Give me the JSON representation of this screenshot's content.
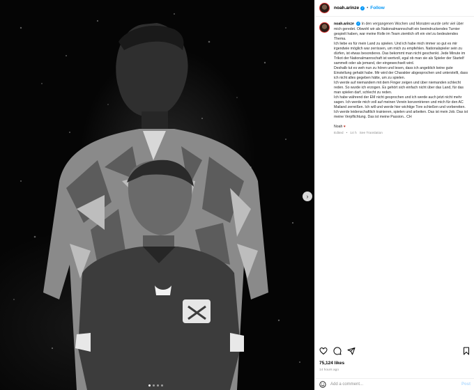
{
  "post": {
    "username": "noah.arinze",
    "follow_label": "Follow",
    "separator": "•",
    "caption": "In den vergangenen Wochen und Monaten wurde sehr viel über mich geredet. Obwohl wir als Nationalmannschaft ein beeindruckendes Turnier gespielt haben, war meine Rolle im Team ziemlich oft ein viel zu bedeutendes Thema.\nIch liebe es für mein Land zu spielen. Und ich habe mich immer so gut es mir irgendwie möglich war zerrissen, um mich zu empfehlen. Nationalspieler sein zu dürfen, ist etwas besonderes. Das bekommt man nicht geschenkt. Jede Minute im Trikot der Nationalmannschaft ist wertvoll, egal ob man sie als Spieler der Startelf sammelt oder als jemand, der eingewechselt wird.\nDeshalb tut es weh nun zu hören und lesen, dass ich angeblich keine gute Einstellung gehabt habe. Mir wird der Charakter abgesprochen und unterstellt, dass ich nicht alles gegeben hätte, um zu spielen.\nIch werde auf niemandem mit dem Finger zeigen und über niemanden schlecht reden. So wurde ich erzogen. Es gehört sich einfach nicht über das Land, für das man spielen darf, schlecht zu reden.\nIch habe während der EM nicht gesprochen und ich werde auch jetzt nicht mehr sagen. Ich werde mich voll auf meinen Verein konzentrieren und mich für den AC Mailand zerreißen. Ich will und werde hier wichtige Tore schießen und vorbereiten. Ich werde leidenschaftlich trainieren, spielen und arbeiten. Das ist mein Job. Das ist meine Verpflichtung. Das ist meine Passion.. ",
    "caption_end_flag": "CH",
    "signature": "Noah",
    "signature_emoji": "♥",
    "edited_label": "Edited",
    "edited_time": "14 h",
    "translation_label": "See Translation",
    "likes": "75,124 likes",
    "time_ago": "14 hours ago",
    "comment_placeholder": "Add a comment...",
    "post_button": "Post"
  },
  "media": {
    "next_icon": "chevron-right-icon",
    "carousel_count": 4,
    "carousel_active": 1
  },
  "icons": {
    "like": "heart-icon",
    "comment": "comment-icon",
    "share": "share-icon",
    "save": "bookmark-icon",
    "emoji": "smiley-icon"
  },
  "colors": {
    "accent": "#0095f6",
    "media_bg": "#050505",
    "secondary_text": "#8e8e8e",
    "post_button_disabled": "#b3dbff"
  }
}
